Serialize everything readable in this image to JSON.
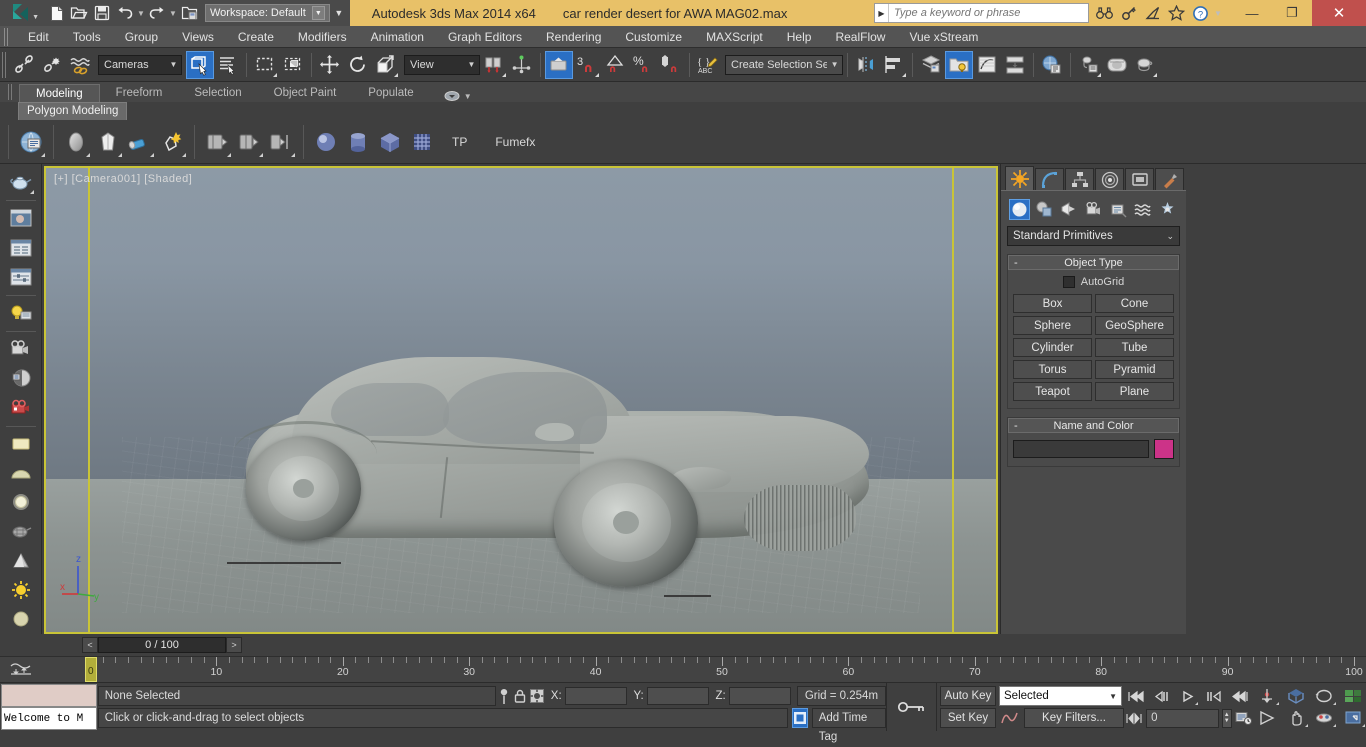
{
  "titlebar": {
    "app_title": "Autodesk 3ds Max  2014 x64",
    "file_name": "car render desert for AWA MAG02.max",
    "workspace_label": "Workspace: Default",
    "search_placeholder": "Type a keyword or phrase",
    "quick_access": [
      {
        "name": "new-file-icon",
        "label": "New"
      },
      {
        "name": "open-file-icon",
        "label": "Open"
      },
      {
        "name": "save-file-icon",
        "label": "Save"
      },
      {
        "name": "undo-icon",
        "label": "Undo"
      },
      {
        "name": "redo-icon",
        "label": "Redo"
      },
      {
        "name": "set-project-folder-icon",
        "label": "Set Project Folder"
      }
    ],
    "help_icons": [
      {
        "name": "search-binoculars-icon",
        "label": "Search"
      },
      {
        "name": "key-icon",
        "label": "Sign In"
      },
      {
        "name": "satellite-dish-icon",
        "label": "Autodesk 360"
      },
      {
        "name": "star-icon",
        "label": "Favorites"
      },
      {
        "name": "help-question-icon",
        "label": "Help"
      }
    ],
    "window_buttons": {
      "minimize": "—",
      "restore": "❐",
      "close": "✕"
    }
  },
  "menubar": {
    "items": [
      {
        "label": "Edit"
      },
      {
        "label": "Tools"
      },
      {
        "label": "Group"
      },
      {
        "label": "Views"
      },
      {
        "label": "Create"
      },
      {
        "label": "Modifiers"
      },
      {
        "label": "Animation"
      },
      {
        "label": "Graph Editors"
      },
      {
        "label": "Rendering"
      },
      {
        "label": "Customize"
      },
      {
        "label": "MAXScript"
      },
      {
        "label": "Help"
      },
      {
        "label": "RealFlow"
      },
      {
        "label": "Vue xStream"
      }
    ]
  },
  "toolbar": {
    "selection_filter": "Cameras",
    "reference_coordinate_system": "View",
    "named_selection_sets": "Create Selection Se",
    "buttons": [
      {
        "name": "select-and-link-icon",
        "label": "Select and Link"
      },
      {
        "name": "unlink-selection-icon",
        "label": "Unlink Selection"
      },
      {
        "name": "bind-to-space-warp-icon",
        "label": "Bind to Space Warp"
      },
      {
        "name": "select-object-icon",
        "label": "Select Object",
        "active": true
      },
      {
        "name": "select-by-name-icon",
        "label": "Select by Name"
      },
      {
        "name": "rectangular-selection-region-icon",
        "label": "Rectangular Selection Region"
      },
      {
        "name": "window-crossing-icon",
        "label": "Window/Crossing"
      },
      {
        "name": "select-and-move-icon",
        "label": "Select and Move"
      },
      {
        "name": "select-and-rotate-icon",
        "label": "Select and Rotate"
      },
      {
        "name": "select-and-scale-icon",
        "label": "Select and Uniform Scale"
      },
      {
        "name": "use-pivot-point-center-icon",
        "label": "Use Pivot Point Center"
      },
      {
        "name": "select-and-manipulate-icon",
        "label": "Select and Manipulate"
      },
      {
        "name": "snaps-toggle-icon",
        "label": "Snaps Toggle 3"
      },
      {
        "name": "angle-snap-toggle-icon",
        "label": "Angle Snap Toggle"
      },
      {
        "name": "percent-snap-toggle-icon",
        "label": "Percent Snap Toggle"
      },
      {
        "name": "spinner-snap-toggle-icon",
        "label": "Spinner Snap Toggle"
      },
      {
        "name": "edit-named-selection-sets-icon",
        "label": "Edit Named Selection Sets"
      },
      {
        "name": "mirror-icon",
        "label": "Mirror"
      },
      {
        "name": "align-icon",
        "label": "Align"
      },
      {
        "name": "layer-explorer-icon",
        "label": "Layer Explorer"
      },
      {
        "name": "toggle-scene-explorer-icon",
        "label": "Toggle Scene Explorer"
      },
      {
        "name": "curve-editor-icon",
        "label": "Curve Editor"
      },
      {
        "name": "schematic-view-icon",
        "label": "Schematic View"
      },
      {
        "name": "material-editor-icon",
        "label": "Material Editor"
      },
      {
        "name": "render-setup-icon",
        "label": "Render Setup"
      },
      {
        "name": "rendered-frame-window-icon",
        "label": "Rendered Frame Window"
      },
      {
        "name": "render-production-icon",
        "label": "Render Production"
      }
    ]
  },
  "ribbon": {
    "tabs": [
      {
        "label": "Modeling",
        "active": true
      },
      {
        "label": "Freeform",
        "active": false
      },
      {
        "label": "Selection",
        "active": false
      },
      {
        "label": "Object Paint",
        "active": false
      },
      {
        "label": "Populate",
        "active": false
      }
    ],
    "panel_name": "Polygon Modeling",
    "buttons": [
      {
        "name": "scene-explorer-icon",
        "label": "Modeling Scene Explorer"
      },
      {
        "name": "vertex-subobject-icon",
        "label": "Vertex"
      },
      {
        "name": "edge-subobject-icon",
        "label": "Edge"
      },
      {
        "name": "border-subobject-icon",
        "label": "Border"
      },
      {
        "name": "polygon-subobject-icon",
        "label": "Polygon"
      },
      {
        "name": "element-subobject-icon",
        "label": "Element"
      },
      {
        "name": "generate-topology-icon",
        "label": "Generate Topology"
      },
      {
        "name": "symmetry-icon",
        "label": "Symmetry"
      }
    ],
    "plugin_buttons": [
      {
        "name": "sphere-primitive-icon",
        "label": "Sphere"
      },
      {
        "name": "cylinder-primitive-icon",
        "label": "Cylinder"
      },
      {
        "name": "box-primitive-icon",
        "label": "Box"
      },
      {
        "name": "grid-primitive-icon",
        "label": "Grid"
      }
    ],
    "plugin_labels": [
      "TP",
      "Fumefx"
    ]
  },
  "left_toolbar": {
    "buttons": [
      {
        "name": "teapot-tool-icon",
        "label": "Teapot"
      },
      {
        "name": "render-preview-icon",
        "label": "Render Preview"
      },
      {
        "name": "scene-list-icon",
        "label": "Scene List"
      },
      {
        "name": "parameter-editor-icon",
        "label": "Parameter Editor"
      },
      {
        "name": "light-lister-icon",
        "label": "Light Lister"
      },
      {
        "name": "camera-tool-icon",
        "label": "Camera"
      },
      {
        "name": "shading-sphere-icon",
        "label": "Shading"
      },
      {
        "name": "stereo-camera-icon",
        "label": "Stereo Camera"
      },
      {
        "name": "plane-primitive-icon",
        "label": "Plane"
      },
      {
        "name": "dome-primitive-icon",
        "label": "Dome"
      },
      {
        "name": "sphere-light-icon",
        "label": "Sphere Light"
      },
      {
        "name": "wire-teapot-icon",
        "label": "Wire Teapot"
      },
      {
        "name": "cone-primitive-icon",
        "label": "Cone"
      },
      {
        "name": "sun-light-icon",
        "label": "Sun Light"
      },
      {
        "name": "sphere-shade-icon",
        "label": "Sphere Shade"
      }
    ]
  },
  "viewport": {
    "label": "[+] [Camera001] [Shaded]",
    "border_color": "#c9c437",
    "sky_color": "#8d9aa6",
    "ground_color": "#99a09e",
    "axis": {
      "x": {
        "label": "x",
        "color": "#d03a3a"
      },
      "y": {
        "label": "y",
        "color": "#3faa3f"
      },
      "z": {
        "label": "z",
        "color": "#3a55d0"
      }
    }
  },
  "timeline": {
    "current_frame_display": "0 / 100",
    "prev_label": "<",
    "next_label": ">",
    "playhead_label": "0",
    "tick_labels": [
      "10",
      "20",
      "30",
      "40",
      "50",
      "60",
      "70",
      "80",
      "90",
      "100"
    ],
    "tick_values": [
      10,
      20,
      30,
      40,
      50,
      60,
      70,
      80,
      90,
      100
    ],
    "range_start": 0,
    "range_end": 100
  },
  "statusbar": {
    "maxscript_listener_text": "Welcome to M",
    "selection_status": "None Selected",
    "prompt_text": "Click or click-and-drag to select objects",
    "coords": {
      "x_label": "X:",
      "x_value": "",
      "y_label": "Y:",
      "y_value": "",
      "z_label": "Z:",
      "z_value": ""
    },
    "grid_info": "Grid = 0.254m",
    "add_time_tag": "Add Time Tag",
    "icons": [
      {
        "name": "selection-lock-pin-icon",
        "label": "Selection Pin"
      },
      {
        "name": "selection-lock-toggle-icon",
        "label": "Selection Lock Toggle"
      },
      {
        "name": "absolute-relative-transform-icon",
        "label": "Absolute/Relative Transform"
      },
      {
        "name": "isolate-selection-icon",
        "label": "Isolate Selection Toggle"
      },
      {
        "name": "key-mode-icon",
        "label": "Key Mode"
      }
    ]
  },
  "animation": {
    "auto_key_label": "Auto Key",
    "set_key_label": "Set Key",
    "selected_filter": "Selected",
    "key_filters_label": "Key Filters...",
    "frame_value": "0",
    "playback_buttons": [
      {
        "name": "go-to-start-icon",
        "label": "Go to Start"
      },
      {
        "name": "previous-frame-icon",
        "label": "Previous Frame"
      },
      {
        "name": "play-animation-icon",
        "label": "Play Animation"
      },
      {
        "name": "next-frame-icon",
        "label": "Next Frame"
      },
      {
        "name": "go-to-end-icon",
        "label": "Go to End"
      },
      {
        "name": "key-mode-toggle-icon",
        "label": "Key Mode Toggle"
      }
    ],
    "nav_buttons": [
      {
        "name": "zoom-icon",
        "label": "Zoom"
      },
      {
        "name": "zoom-all-icon",
        "label": "Zoom All"
      },
      {
        "name": "zoom-extents-icon",
        "label": "Zoom Extents"
      },
      {
        "name": "zoom-region-icon",
        "label": "Zoom Region"
      },
      {
        "name": "field-of-view-icon",
        "label": "Field of View"
      },
      {
        "name": "pan-view-icon",
        "label": "Pan View"
      },
      {
        "name": "orbit-icon",
        "label": "Orbit"
      },
      {
        "name": "maximize-viewport-icon",
        "label": "Maximize Viewport Toggle"
      }
    ]
  },
  "command_panel": {
    "tabs": [
      {
        "name": "create-tab",
        "label": "Create",
        "active": true
      },
      {
        "name": "modify-tab",
        "label": "Modify",
        "active": false
      },
      {
        "name": "hierarchy-tab",
        "label": "Hierarchy",
        "active": false
      },
      {
        "name": "motion-tab",
        "label": "Motion",
        "active": false
      },
      {
        "name": "display-tab",
        "label": "Display",
        "active": false
      },
      {
        "name": "utilities-tab",
        "label": "Utilities",
        "active": false
      }
    ],
    "categories": [
      {
        "name": "geometry-category-icon",
        "label": "Geometry",
        "active": true
      },
      {
        "name": "shapes-category-icon",
        "label": "Shapes",
        "active": false
      },
      {
        "name": "lights-category-icon",
        "label": "Lights",
        "active": false
      },
      {
        "name": "cameras-category-icon",
        "label": "Cameras",
        "active": false
      },
      {
        "name": "helpers-category-icon",
        "label": "Helpers",
        "active": false
      },
      {
        "name": "space-warps-category-icon",
        "label": "Space Warps",
        "active": false
      },
      {
        "name": "systems-category-icon",
        "label": "Systems",
        "active": false
      }
    ],
    "primitive_type": "Standard Primitives",
    "object_type": {
      "title": "Object Type",
      "collapse_mark": "-",
      "autogrid_label": "AutoGrid",
      "autogrid_checked": false,
      "buttons": [
        "Box",
        "Cone",
        "Sphere",
        "GeoSphere",
        "Cylinder",
        "Tube",
        "Torus",
        "Pyramid",
        "Teapot",
        "Plane"
      ]
    },
    "name_and_color": {
      "title": "Name and Color",
      "collapse_mark": "-",
      "name_value": "",
      "color": "#cc3388"
    }
  }
}
